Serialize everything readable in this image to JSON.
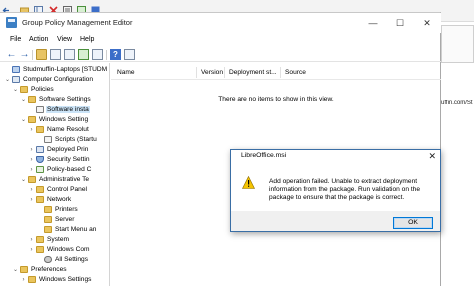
{
  "window": {
    "title": "Group Policy Management Editor",
    "minimize": "—",
    "maximize": "☐",
    "close": "✕"
  },
  "background_window": {
    "url_fragment": "uffin.com/St"
  },
  "menu": [
    "File",
    "Action",
    "View",
    "Help"
  ],
  "tree": [
    {
      "label": "Studmuffin-Laptops [STUDM",
      "expander": "",
      "icon": "policy-icon",
      "selected": false
    },
    {
      "label": "Computer Configuration",
      "expander": "⌄",
      "icon": "computer-icon",
      "selected": false
    },
    {
      "label": "Policies",
      "expander": "⌄",
      "icon": "folder-icon",
      "selected": false
    },
    {
      "label": "Software Settings",
      "expander": "⌄",
      "icon": "folder-icon",
      "selected": false
    },
    {
      "label": "Software insta",
      "expander": "",
      "icon": "software-install-icon",
      "selected": true
    },
    {
      "label": "Windows Setting",
      "expander": "⌄",
      "icon": "folder-icon",
      "selected": false
    },
    {
      "label": "Name Resolut",
      "expander": "›",
      "icon": "folder-icon",
      "selected": false
    },
    {
      "label": "Scripts (Startu",
      "expander": "",
      "icon": "scripts-icon",
      "selected": false
    },
    {
      "label": "Deployed Prin",
      "expander": "›",
      "icon": "printer-icon",
      "selected": false
    },
    {
      "label": "Security Settin",
      "expander": "›",
      "icon": "security-icon",
      "selected": false
    },
    {
      "label": "Policy-based C",
      "expander": "›",
      "icon": "chart-icon",
      "selected": false
    },
    {
      "label": "Administrative Te",
      "expander": "⌄",
      "icon": "folder-icon",
      "selected": false
    },
    {
      "label": "Control Panel",
      "expander": "›",
      "icon": "folder-icon",
      "selected": false
    },
    {
      "label": "Network",
      "expander": "›",
      "icon": "folder-icon",
      "selected": false
    },
    {
      "label": "Printers",
      "expander": "",
      "icon": "folder-icon",
      "selected": false
    },
    {
      "label": "Server",
      "expander": "",
      "icon": "folder-icon",
      "selected": false
    },
    {
      "label": "Start Menu an",
      "expander": "",
      "icon": "folder-icon",
      "selected": false
    },
    {
      "label": "System",
      "expander": "›",
      "icon": "folder-icon",
      "selected": false
    },
    {
      "label": "Windows Com",
      "expander": "›",
      "icon": "folder-icon",
      "selected": false
    },
    {
      "label": "All Settings",
      "expander": "",
      "icon": "all-settings-icon",
      "selected": false
    },
    {
      "label": "Preferences",
      "expander": "⌄",
      "icon": "folder-icon",
      "selected": false
    },
    {
      "label": "Windows Settings",
      "expander": "›",
      "icon": "folder-icon",
      "selected": false
    }
  ],
  "columns": [
    "Name",
    "Version",
    "Deployment st...",
    "Source"
  ],
  "empty_message": "There are no items to show in this view.",
  "dialog": {
    "title": "LibreOffice.msi",
    "close": "✕",
    "message": "Add operation failed.  Unable to extract deployment information from the package.  Run validation on the package to ensure that the package is correct.",
    "ok_label": "OK",
    "icon": "warning-icon",
    "accent_color": "#0078d7"
  }
}
